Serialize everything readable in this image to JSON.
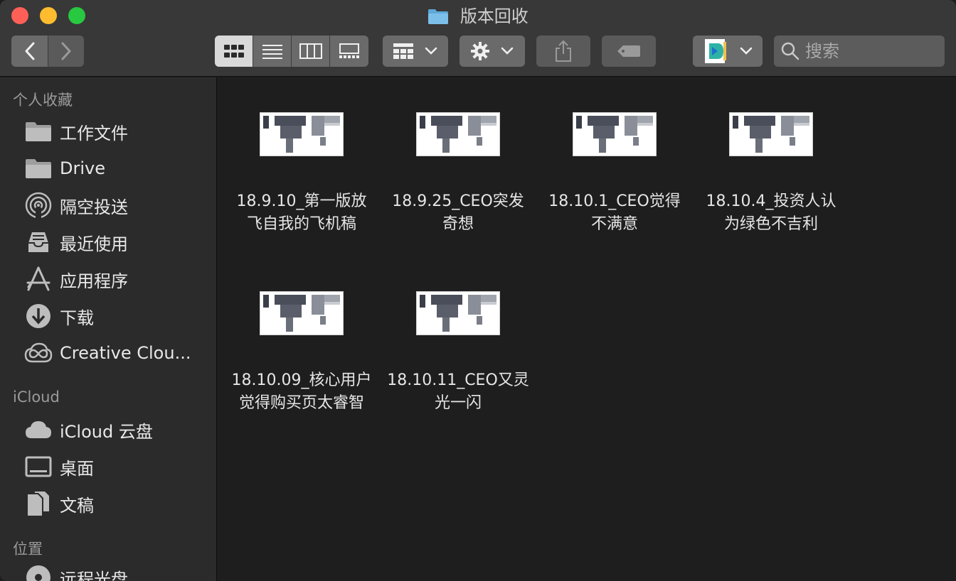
{
  "window": {
    "title": "版本回收"
  },
  "toolbar": {
    "search_placeholder": "搜索"
  },
  "sidebar": {
    "sections": [
      {
        "header": "个人收藏",
        "items": [
          {
            "label": "工作文件",
            "icon": "folder-icon"
          },
          {
            "label": "Drive",
            "icon": "folder-icon"
          },
          {
            "label": "隔空投送",
            "icon": "airdrop-icon"
          },
          {
            "label": "最近使用",
            "icon": "recents-icon"
          },
          {
            "label": "应用程序",
            "icon": "applications-icon"
          },
          {
            "label": "下载",
            "icon": "download-icon"
          },
          {
            "label": "Creative Clou...",
            "icon": "creative-cloud-icon"
          }
        ]
      },
      {
        "header": "iCloud",
        "items": [
          {
            "label": "iCloud 云盘",
            "icon": "cloud-icon"
          },
          {
            "label": "桌面",
            "icon": "desktop-icon"
          },
          {
            "label": "文稿",
            "icon": "documents-icon"
          }
        ]
      },
      {
        "header": "位置",
        "items": [
          {
            "label": "远程光盘",
            "icon": "disc-icon"
          }
        ]
      }
    ]
  },
  "files": [
    {
      "line1": "18.9.10_第一版放",
      "line2": "飞自我的飞机稿"
    },
    {
      "line1": "18.9.25_CEO突发",
      "line2": "奇想"
    },
    {
      "line1": "18.10.1_CEO觉得",
      "line2": "不满意"
    },
    {
      "line1": "18.10.4_投资人认",
      "line2": "为绿色不吉利"
    },
    {
      "line1": "18.10.09_核心用户",
      "line2": "觉得购买页太睿智"
    },
    {
      "line1": "18.10.11_CEO又灵",
      "line2": "光一闪"
    }
  ]
}
